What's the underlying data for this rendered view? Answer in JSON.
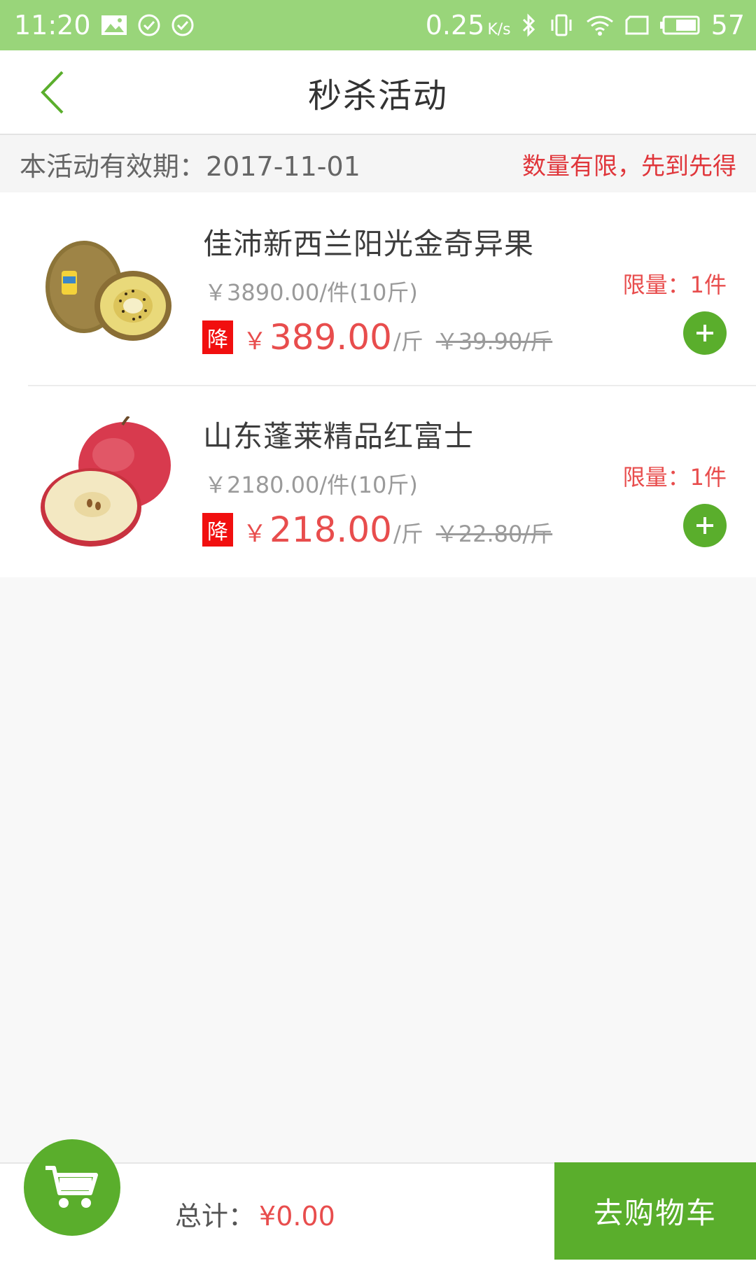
{
  "status_bar": {
    "time": "11:20",
    "speed": "0.25",
    "speed_unit": "K/s",
    "battery": "57",
    "icons": [
      "image-icon",
      "check-circle-icon",
      "check-circle-icon",
      "bluetooth-icon",
      "vibrate-icon",
      "wifi-icon",
      "sim-card-icon",
      "battery-icon"
    ]
  },
  "header": {
    "title": "秒杀活动",
    "back_icon": "chevron-left-icon"
  },
  "info_bar": {
    "validity": "本活动有效期：2017-11-01",
    "notice": "数量有限，先到先得"
  },
  "products": [
    {
      "name": "佳沛新西兰阳光金奇异果",
      "pack_price": "￥3890.00/件(10斤)",
      "drop_badge": "降",
      "yen": "￥",
      "price": "389.00",
      "unit": "/斤",
      "old_price": "￥39.90/斤",
      "limit": "限量：1件",
      "image": "kiwi-fruit-image"
    },
    {
      "name": "山东蓬莱精品红富士",
      "pack_price": "￥2180.00/件(10斤)",
      "drop_badge": "降",
      "yen": "￥",
      "price": "218.00",
      "unit": "/斤",
      "old_price": "￥22.80/斤",
      "limit": "限量：1件",
      "image": "apple-image"
    }
  ],
  "footer": {
    "total_label": "总计：",
    "total_value": "¥0.00",
    "checkout_label": "去购物车",
    "cart_icon": "shopping-cart-icon"
  },
  "colors": {
    "status_bar": "#99d57a",
    "accent_green": "#5aae2c",
    "price_red": "#e84d4d",
    "badge_red": "#f10f0f"
  }
}
